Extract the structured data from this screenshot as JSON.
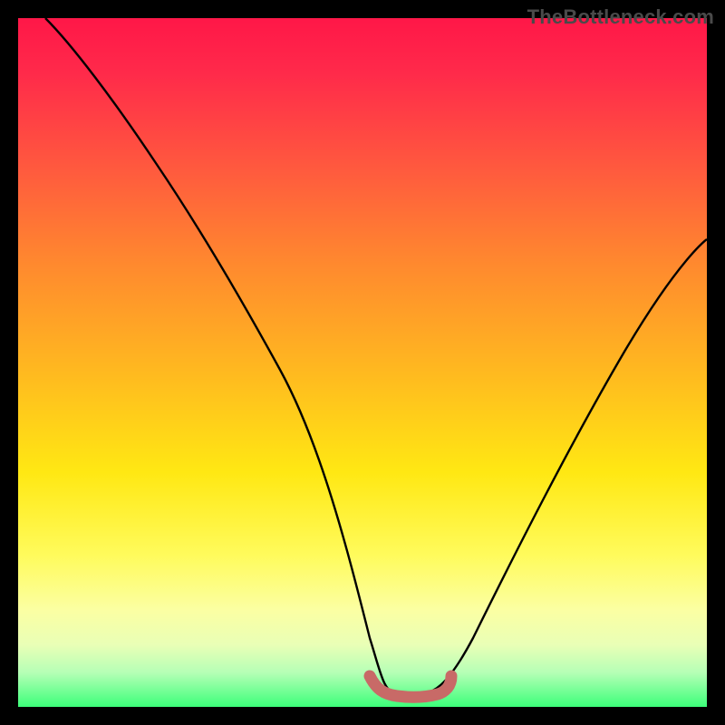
{
  "watermark": "TheBottleneck.com",
  "chart_data": {
    "type": "line",
    "title": "",
    "xlabel": "",
    "ylabel": "",
    "xlim": [
      0,
      100
    ],
    "ylim": [
      0,
      100
    ],
    "series": [
      {
        "name": "bottleneck-curve",
        "x": [
          4,
          8,
          14,
          20,
          26,
          32,
          38,
          44,
          48,
          51,
          53,
          55,
          57,
          59,
          61,
          63,
          66,
          72,
          80,
          88,
          96,
          100
        ],
        "y": [
          100,
          96,
          88,
          79,
          70,
          60,
          49,
          36,
          22,
          10,
          3,
          1,
          0,
          0,
          1,
          3,
          9,
          22,
          38,
          52,
          63,
          68
        ]
      },
      {
        "name": "tolerance-band",
        "x": [
          51,
          53,
          55,
          57,
          59,
          61,
          63
        ],
        "y": [
          3,
          1.5,
          1,
          1,
          1,
          1.5,
          3
        ]
      }
    ],
    "colors": {
      "curve": "#000000",
      "band": "#c86a67",
      "gradient_top": "#ff1748",
      "gradient_bottom": "#3cff7a"
    }
  }
}
